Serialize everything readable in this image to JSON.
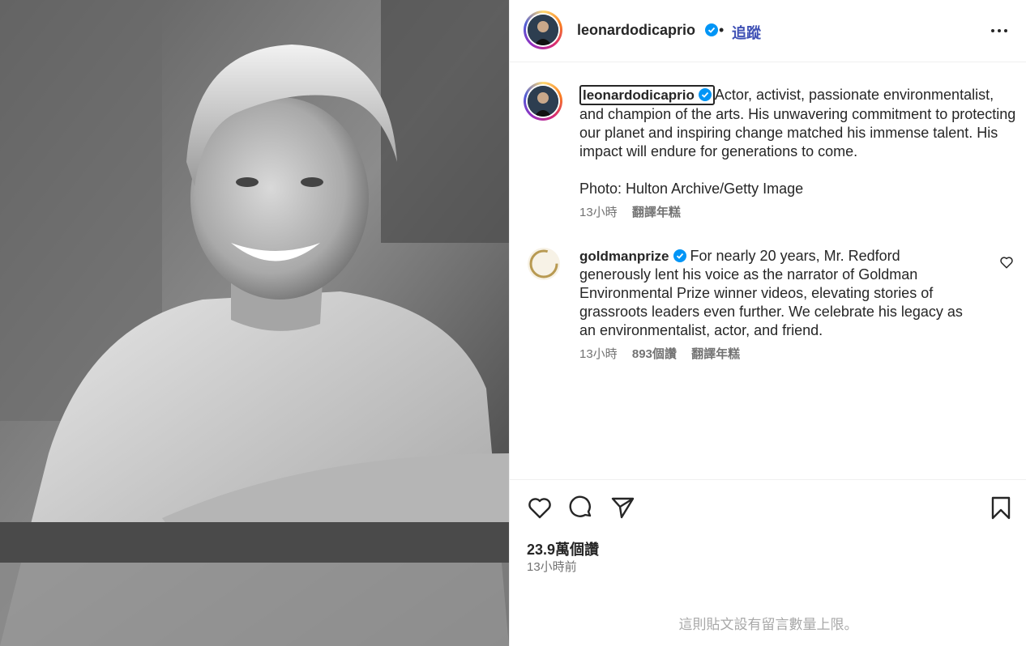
{
  "post": {
    "photo_alt": "",
    "icon": "black-and-white-portrait-photo"
  },
  "header": {
    "username": "leonardodicaprio",
    "verified_icon": "verified-badge-icon",
    "separator": "•",
    "follow_label": "追蹤",
    "more_icon": "more-options-icon"
  },
  "caption": {
    "username": "leonardodicaprio",
    "text": "Actor, activist, passionate environmentalist, and champion of the arts. His unwavering commitment to protecting our planet and inspiring change matched his immense talent. His impact will endure for generations to come.",
    "photo_credit": "Photo: Hulton Archive/Getty Image",
    "time": "13小時",
    "translate_label": "翻譯年糕"
  },
  "comment": {
    "username": "goldmanprize",
    "text": "For nearly 20 years, Mr. Redford generously lent his voice as the narrator of Goldman Environmental Prize winner videos, elevating stories of grassroots leaders even further. We celebrate his legacy as an environmentalist, actor, and friend.",
    "time": "13小時",
    "likes": "893個讚",
    "translate_label": "翻譯年糕"
  },
  "actions": {
    "like_icon": "heart-icon",
    "comment_icon": "comment-bubble-icon",
    "share_icon": "paper-plane-icon",
    "save_icon": "bookmark-icon"
  },
  "footer": {
    "likes_count": "23.9萬個讚",
    "posted_time": "13小時前",
    "comments_limited": "這則貼文設有留言數量上限。"
  },
  "colors": {
    "follow": "#3f51b5",
    "verified": "#0095f6",
    "secondary_text": "#737373",
    "muted_text": "#a8a8a8"
  }
}
